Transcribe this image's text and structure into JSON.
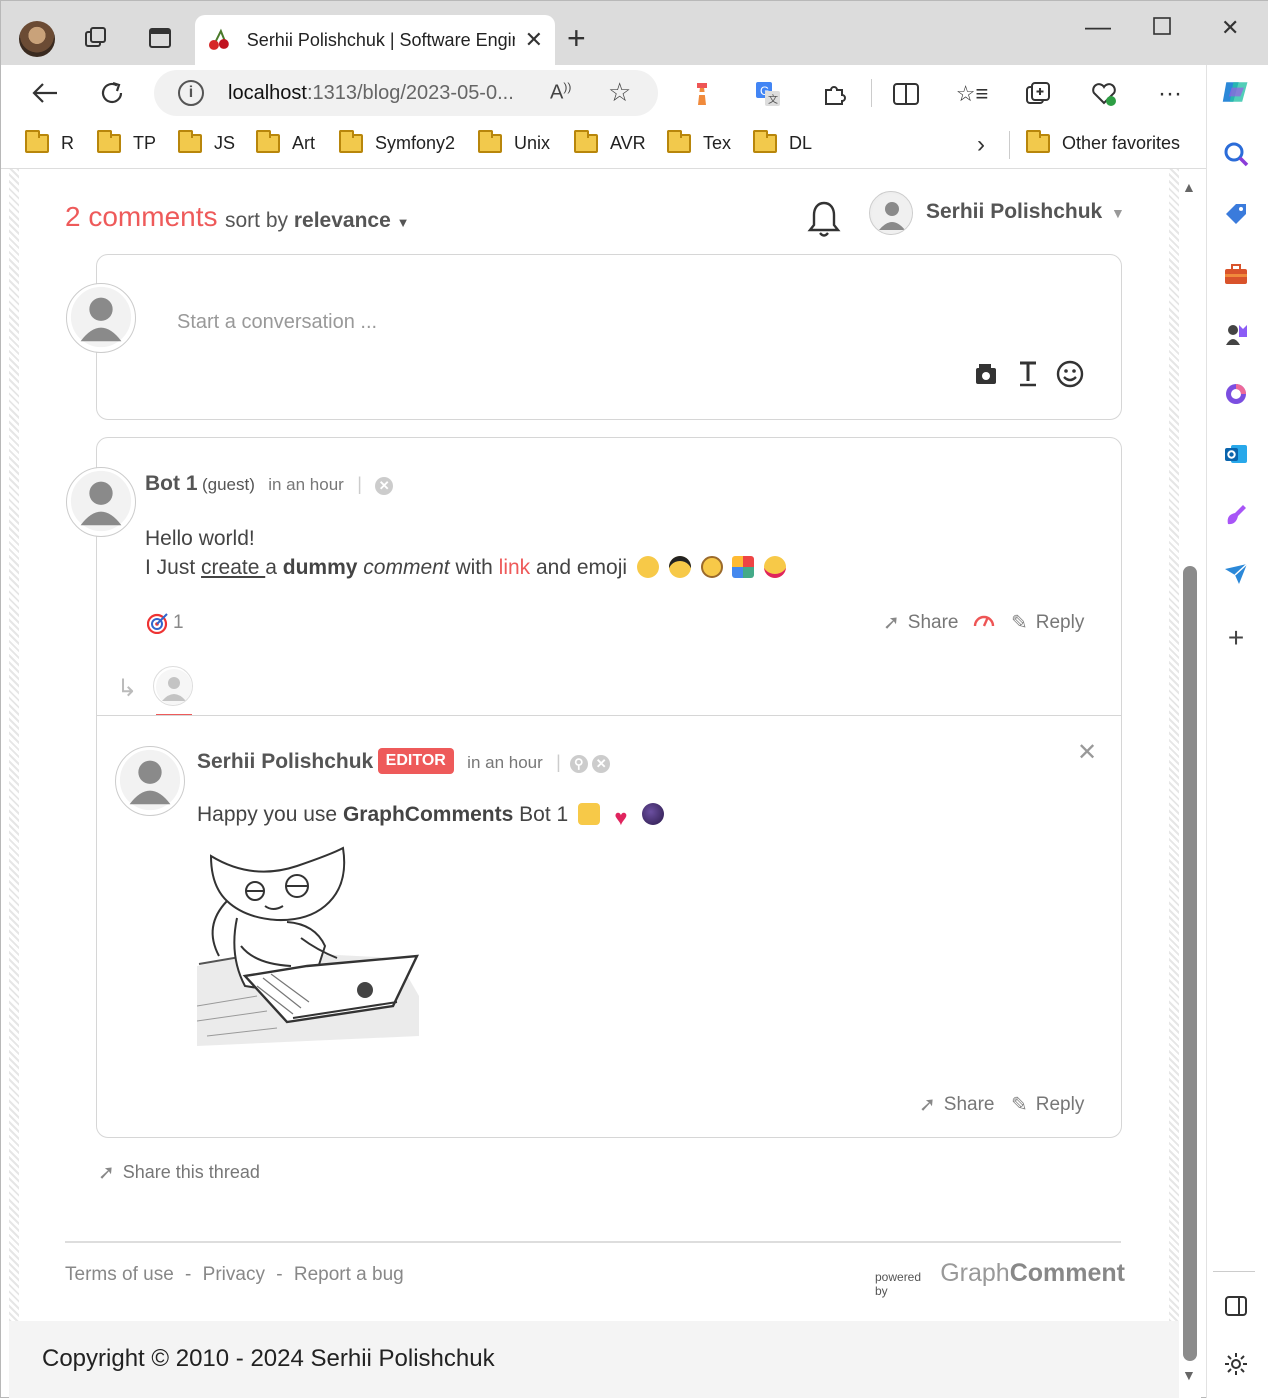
{
  "browser": {
    "tab_title": "Serhii Polishchuk | Software Engir",
    "url_host": "localhost",
    "url_path": ":1313/blog/2023-05-0...",
    "favorites": [
      "R",
      "TP",
      "JS",
      "Art",
      "Symfony2",
      "Unix",
      "AVR",
      "Tex",
      "DL"
    ],
    "other_favorites": "Other favorites"
  },
  "comments": {
    "count_label": "2 comments",
    "sort_prefix": "sort by",
    "sort_value": "relevance",
    "current_user": "Serhii Polishchuk",
    "composer_placeholder": "Start a conversation ..."
  },
  "comment1": {
    "author": "Bot 1",
    "guest": "(guest)",
    "time": "in an hour",
    "line1": "Hello world!",
    "line2_a": "I Just ",
    "line2_create": "create ",
    "line2_b": "a ",
    "line2_dummy": "dummy",
    "line2_c": " ",
    "line2_comment": "comment",
    "line2_d": " with ",
    "line2_link": "link",
    "line2_e": " and emoji",
    "vote_count": "1",
    "share": "Share",
    "reply": "Reply"
  },
  "reply1": {
    "author": "Serhii Polishchuk",
    "badge": "EDITOR",
    "time": "in an hour",
    "text_a": "Happy you use ",
    "text_b": "GraphComments",
    "text_c": " Bot 1",
    "share": "Share",
    "reply": "Reply"
  },
  "thread": {
    "share_thread": "Share this thread"
  },
  "footer": {
    "terms": "Terms of use",
    "privacy": "Privacy",
    "report": "Report a bug",
    "sep": "-",
    "powered_by": "powered by",
    "brand_light": "Graph",
    "brand_bold": "Comment",
    "copyright": "Copyright © 2010 - 2024 Serhii Polishchuk"
  },
  "colors": {
    "accent": "#ee5a5a",
    "text": "#555555"
  }
}
